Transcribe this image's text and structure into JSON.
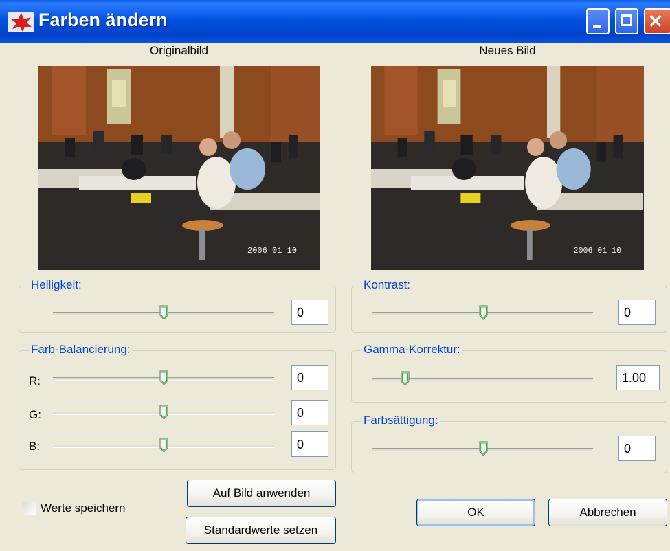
{
  "window": {
    "title": "Farben ändern"
  },
  "titlebar_icons": [
    "app-icon",
    "minimize-icon",
    "maximize-icon",
    "close-icon"
  ],
  "images": {
    "original_label": "Originalbild",
    "new_label": "Neues Bild",
    "timestamp_overlay": "2006 01 10"
  },
  "brightness": {
    "label": "Helligkeit:",
    "value": "0",
    "slider_fraction": 0.5
  },
  "contrast": {
    "label": "Kontrast:",
    "value": "0",
    "slider_fraction": 0.5
  },
  "color_balance": {
    "label": "Farb-Balancierung:",
    "channels": [
      {
        "name": "R:",
        "value": "0",
        "slider_fraction": 0.5
      },
      {
        "name": "G:",
        "value": "0",
        "slider_fraction": 0.5
      },
      {
        "name": "B:",
        "value": "0",
        "slider_fraction": 0.5
      }
    ]
  },
  "gamma": {
    "label": "Gamma-Korrektur:",
    "value": "1.00",
    "slider_fraction": 0.15
  },
  "saturation": {
    "label": "Farbsättigung:",
    "value": "0",
    "slider_fraction": 0.5
  },
  "save_values": {
    "label": "Werte speichern",
    "checked": false
  },
  "buttons": {
    "apply": "Auf Bild anwenden",
    "defaults": "Standardwerte setzen",
    "ok": "OK",
    "cancel": "Abbrechen"
  }
}
